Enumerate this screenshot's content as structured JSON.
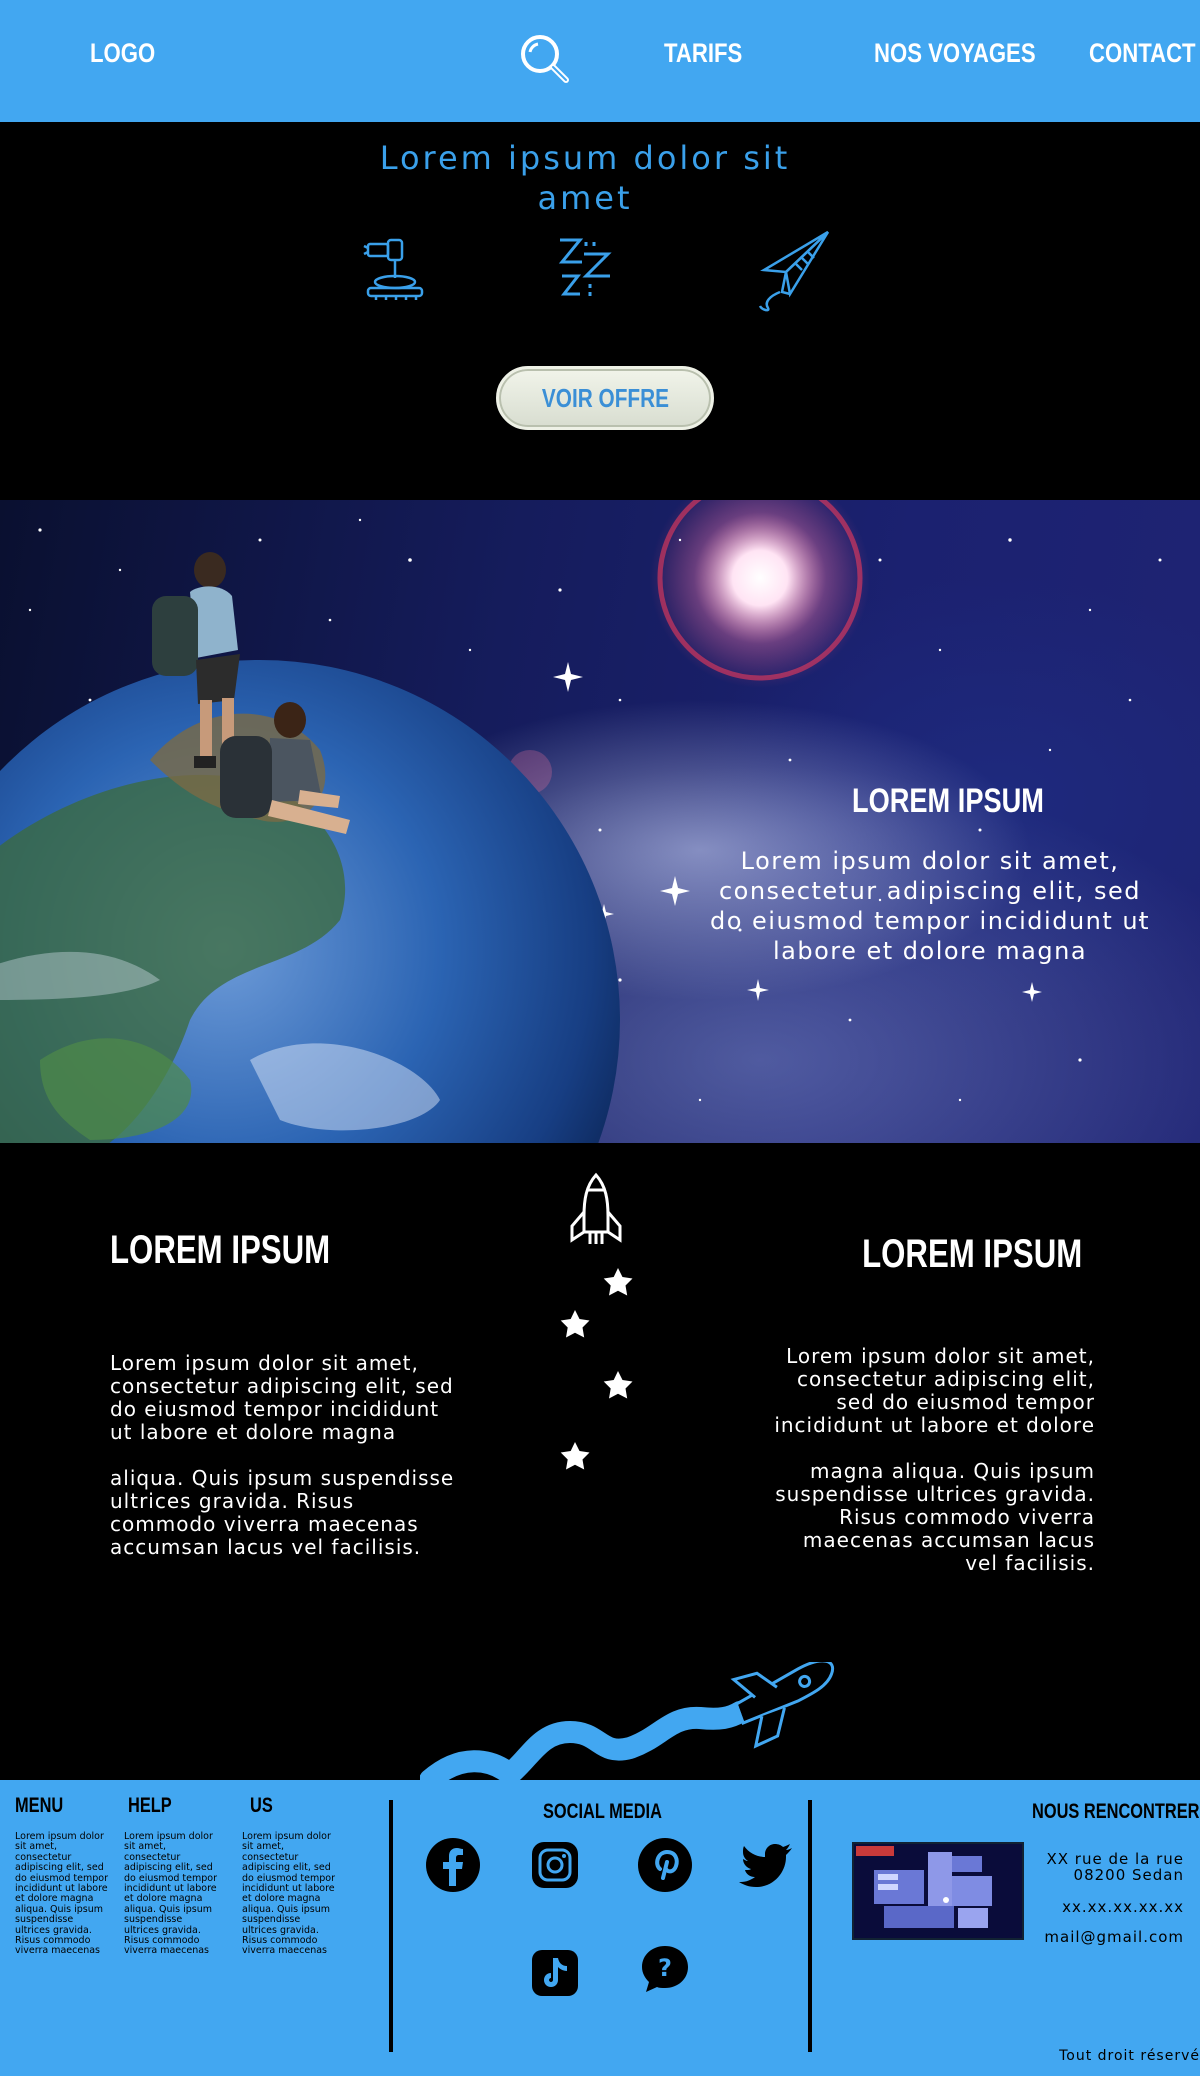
{
  "header": {
    "logo": "LOGO",
    "nav": [
      "TARIFS",
      "NOS VOYAGES",
      "CONTACT"
    ]
  },
  "hero": {
    "title": "Lorem ipsum dolor sit amet",
    "cta_label": "VOIR OFFRE",
    "icons": [
      "telescope-icon",
      "sleep-zzz-icon",
      "paper-plane-icon"
    ]
  },
  "banner": {
    "title": "LOREM IPSUM",
    "body": "Lorem ipsum dolor sit amet, consectetur adipiscing elit, sed do eiusmod tempor incididunt ut labore et dolore magna"
  },
  "middle": {
    "left_title": "LOREM IPSUM",
    "left_body_1": "Lorem ipsum dolor sit amet,\nconsectetur adipiscing elit, sed\ndo eiusmod tempor incididunt\nut labore et dolore magna",
    "left_body_2": "aliqua. Quis ipsum suspendisse\nultrices gravida. Risus\ncommodo viverra maecenas\naccumsan lacus vel facilisis.",
    "right_title": "LOREM IPSUM",
    "right_body_1": "Lorem ipsum dolor sit amet,\nconsectetur adipiscing elit,\nsed do eiusmod tempor\nincididunt ut labore et dolore",
    "right_body_2": "magna aliqua. Quis ipsum\nsuspendisse ultrices gravida.\nRisus commodo viverra\nmaecenas accumsan lacus\nvel facilisis."
  },
  "footer": {
    "columns": [
      {
        "title": "MENU",
        "text": "Lorem ipsum dolor sit amet, consectetur adipiscing elit, sed do eiusmod tempor incididunt ut labore et dolore magna aliqua. Quis ipsum suspendisse ultrices gravida. Risus commodo viverra maecenas"
      },
      {
        "title": "HELP",
        "text": "Lorem ipsum dolor sit amet, consectetur adipiscing elit, sed do eiusmod tempor incididunt ut labore et dolore magna aliqua. Quis ipsum suspendisse ultrices gravida. Risus commodo viverra maecenas"
      },
      {
        "title": "US",
        "text": "Lorem ipsum dolor sit amet, consectetur adipiscing elit, sed do eiusmod tempor incididunt ut labore et dolore magna aliqua. Quis ipsum suspendisse ultrices gravida. Risus commodo viverra maecenas"
      }
    ],
    "social_title": "SOCIAL MEDIA",
    "social_icons": [
      "facebook-icon",
      "instagram-icon",
      "pinterest-icon",
      "twitter-icon",
      "tiktok-icon",
      "help-chat-icon"
    ],
    "meet_title": "NOUS RENCONTRER",
    "address_line1": "XX rue de la rue",
    "address_line2": "08200 Sedan",
    "phone": "xx.xx.xx.xx.xx",
    "email": "mail@gmail.com",
    "copyright": "Tout droit réservé"
  },
  "colors": {
    "accent": "#42a7f1",
    "hero_text": "#3aa0ea",
    "background": "#000000"
  }
}
